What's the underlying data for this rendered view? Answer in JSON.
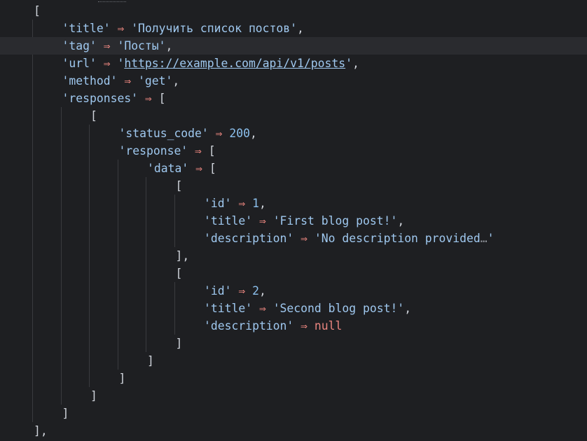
{
  "lines": [
    {
      "indent": 0,
      "parts": [
        {
          "t": "[",
          "c": "punc"
        }
      ]
    },
    {
      "indent": 1,
      "parts": [
        {
          "t": "'title'",
          "c": "key"
        },
        {
          "t": " ⇒ ",
          "c": "arrow"
        },
        {
          "t": "'Получить список постов'",
          "c": "str"
        },
        {
          "t": ",",
          "c": "punc"
        }
      ]
    },
    {
      "indent": 1,
      "current": true,
      "parts": [
        {
          "t": "'tag'",
          "c": "key"
        },
        {
          "t": " ⇒ ",
          "c": "arrow"
        },
        {
          "t": "'Посты'",
          "c": "str"
        },
        {
          "t": ",",
          "c": "punc"
        }
      ]
    },
    {
      "indent": 1,
      "parts": [
        {
          "t": "'url'",
          "c": "key"
        },
        {
          "t": " ⇒ ",
          "c": "arrow"
        },
        {
          "t": "'",
          "c": "str"
        },
        {
          "t": "https://example.com/api/v1/posts",
          "c": "link"
        },
        {
          "t": "'",
          "c": "str"
        },
        {
          "t": ",",
          "c": "punc"
        }
      ]
    },
    {
      "indent": 1,
      "parts": [
        {
          "t": "'method'",
          "c": "key"
        },
        {
          "t": " ⇒ ",
          "c": "arrow"
        },
        {
          "t": "'get'",
          "c": "str"
        },
        {
          "t": ",",
          "c": "punc"
        }
      ]
    },
    {
      "indent": 1,
      "parts": [
        {
          "t": "'responses'",
          "c": "key"
        },
        {
          "t": " ⇒ ",
          "c": "arrow"
        },
        {
          "t": "[",
          "c": "punc"
        }
      ]
    },
    {
      "indent": 2,
      "parts": [
        {
          "t": "[",
          "c": "punc"
        }
      ]
    },
    {
      "indent": 3,
      "parts": [
        {
          "t": "'status_code'",
          "c": "key"
        },
        {
          "t": " ⇒ ",
          "c": "arrow"
        },
        {
          "t": "200",
          "c": "num"
        },
        {
          "t": ",",
          "c": "punc"
        }
      ]
    },
    {
      "indent": 3,
      "parts": [
        {
          "t": "'response'",
          "c": "key"
        },
        {
          "t": " ⇒ ",
          "c": "arrow"
        },
        {
          "t": "[",
          "c": "punc"
        }
      ]
    },
    {
      "indent": 4,
      "parts": [
        {
          "t": "'data'",
          "c": "key"
        },
        {
          "t": " ⇒ ",
          "c": "arrow"
        },
        {
          "t": "[",
          "c": "punc"
        }
      ]
    },
    {
      "indent": 5,
      "parts": [
        {
          "t": "[",
          "c": "punc"
        }
      ]
    },
    {
      "indent": 6,
      "parts": [
        {
          "t": "'id'",
          "c": "key"
        },
        {
          "t": " ⇒ ",
          "c": "arrow"
        },
        {
          "t": "1",
          "c": "num"
        },
        {
          "t": ",",
          "c": "punc"
        }
      ]
    },
    {
      "indent": 6,
      "parts": [
        {
          "t": "'title'",
          "c": "key"
        },
        {
          "t": " ⇒ ",
          "c": "arrow"
        },
        {
          "t": "'First blog post!'",
          "c": "str"
        },
        {
          "t": ",",
          "c": "punc"
        }
      ]
    },
    {
      "indent": 6,
      "parts": [
        {
          "t": "'description'",
          "c": "key"
        },
        {
          "t": " ⇒ ",
          "c": "arrow"
        },
        {
          "t": "'No description provided",
          "c": "str"
        },
        {
          "t": "…",
          "c": "fold"
        },
        {
          "t": "'",
          "c": "str"
        }
      ]
    },
    {
      "indent": 5,
      "parts": [
        {
          "t": "],",
          "c": "punc"
        }
      ]
    },
    {
      "indent": 5,
      "parts": [
        {
          "t": "[",
          "c": "punc"
        }
      ]
    },
    {
      "indent": 6,
      "parts": [
        {
          "t": "'id'",
          "c": "key"
        },
        {
          "t": " ⇒ ",
          "c": "arrow"
        },
        {
          "t": "2",
          "c": "num"
        },
        {
          "t": ",",
          "c": "punc"
        }
      ]
    },
    {
      "indent": 6,
      "parts": [
        {
          "t": "'title'",
          "c": "key"
        },
        {
          "t": " ⇒ ",
          "c": "arrow"
        },
        {
          "t": "'Second blog post!'",
          "c": "str"
        },
        {
          "t": ",",
          "c": "punc"
        }
      ]
    },
    {
      "indent": 6,
      "parts": [
        {
          "t": "'description'",
          "c": "key"
        },
        {
          "t": " ⇒ ",
          "c": "arrow"
        },
        {
          "t": "null",
          "c": "null"
        }
      ]
    },
    {
      "indent": 5,
      "parts": [
        {
          "t": "]",
          "c": "punc"
        }
      ]
    },
    {
      "indent": 4,
      "parts": [
        {
          "t": "]",
          "c": "punc"
        }
      ]
    },
    {
      "indent": 3,
      "parts": [
        {
          "t": "]",
          "c": "punc"
        }
      ]
    },
    {
      "indent": 2,
      "parts": [
        {
          "t": "]",
          "c": "punc"
        }
      ]
    },
    {
      "indent": 1,
      "parts": [
        {
          "t": "]",
          "c": "punc"
        }
      ]
    },
    {
      "indent": 0,
      "parts": [
        {
          "t": "],",
          "c": "punc"
        }
      ]
    }
  ],
  "colors": {
    "background": "#1e1f22",
    "current_line": "#2a2b2f",
    "string": "#9fc8ef",
    "arrow": "#e9857f",
    "number": "#8cc0ee",
    "null": "#e9857f",
    "indent_guide": "#3a3b3f"
  }
}
